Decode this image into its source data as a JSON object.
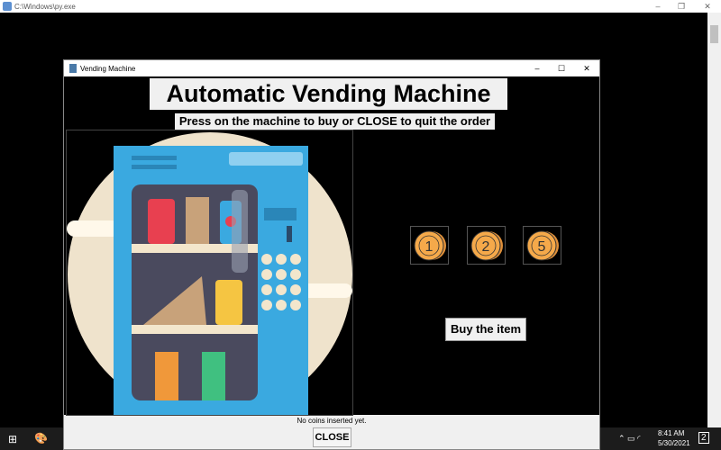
{
  "console": {
    "title": "C:\\Windows\\py.exe"
  },
  "window": {
    "title": "Vending Machine"
  },
  "app": {
    "title": "Automatic Vending Machine",
    "subtitle": "Press on the machine to buy or CLOSE to quit the order",
    "coins": [
      {
        "label": "1"
      },
      {
        "label": "2"
      },
      {
        "label": "5"
      }
    ],
    "buy_label": "Buy the item",
    "status": "No coins inserted yet.",
    "close_label": "CLOSE"
  },
  "taskbar": {
    "time": "8:41 AM",
    "date": "5/30/2021",
    "notifications": "2"
  },
  "colors": {
    "coin": "#f5a94a",
    "machine": "#3aa9e0",
    "background": "#000000"
  }
}
